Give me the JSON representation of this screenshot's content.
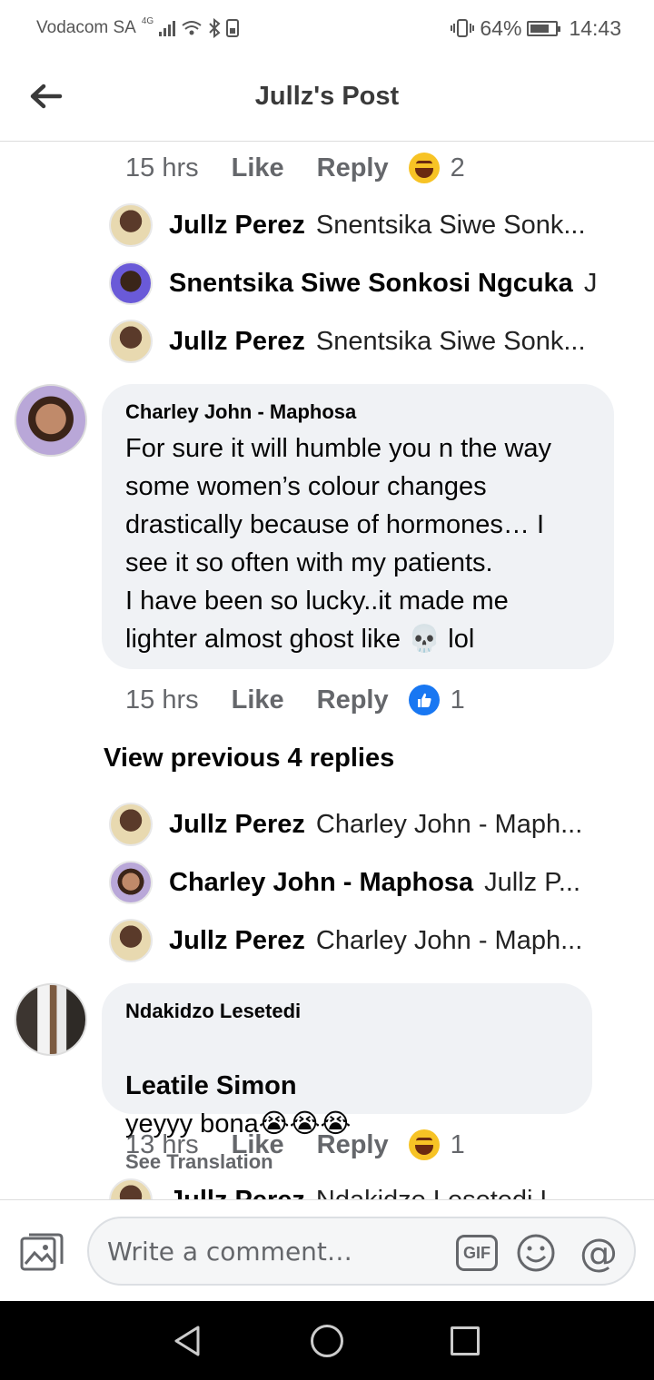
{
  "status_bar": {
    "carrier": "Vodacom SA",
    "network": "4G",
    "battery": "64%",
    "time": "14:43"
  },
  "header": {
    "title": "Jullz's Post"
  },
  "thread_top": {
    "time": "15 hrs",
    "like": "Like",
    "reply": "Reply",
    "reaction_count": "2",
    "replies": [
      {
        "name": "Jullz Perez",
        "snippet": "Snentsika Siwe Sonk..."
      },
      {
        "name": "Snentsika Siwe Sonkosi Ngcuka",
        "snippet": "J"
      },
      {
        "name": "Jullz Perez",
        "snippet": "Snentsika Siwe Sonk..."
      }
    ]
  },
  "comment1": {
    "author": "Charley John - Maphosa",
    "text": "For sure it will humble you n the way\nsome women’s colour changes\ndrastically because of hormones… I\nsee it so often with my patients.\nI have been so lucky..it made me\nlighter almost ghost like 💀 lol",
    "time": "15 hrs",
    "like": "Like",
    "reply": "Reply",
    "reaction_count": "1",
    "view_previous": "View previous 4 replies",
    "replies": [
      {
        "name": "Jullz Perez",
        "snippet": "Charley John - Maph..."
      },
      {
        "name": "Charley John - Maphosa",
        "snippet": "Jullz P..."
      },
      {
        "name": "Jullz Perez",
        "snippet": "Charley John - Maph..."
      }
    ]
  },
  "comment2": {
    "author": "Ndakidzo Lesetedi",
    "tag": "Leatile Simon",
    "text": "yeyyy bona😭😭😭",
    "see_translation": "See Translation",
    "time": "13 hrs",
    "like": "Like",
    "reply": "Reply",
    "reaction_count": "1",
    "partial_reply": {
      "name": "Jullz Perez",
      "snippet": "Ndakidzo Lesetedi L"
    }
  },
  "composer": {
    "placeholder": "Write a comment…",
    "gif_label": "GIF"
  },
  "icons": {
    "back": "arrow-left-icon",
    "photo": "photo-icon",
    "gif": "gif-icon",
    "emoji": "smiley-icon",
    "mention": "at-icon"
  },
  "colors": {
    "accent": "#1877f2",
    "bubble": "#f0f2f5",
    "meta_text": "#65676b"
  }
}
